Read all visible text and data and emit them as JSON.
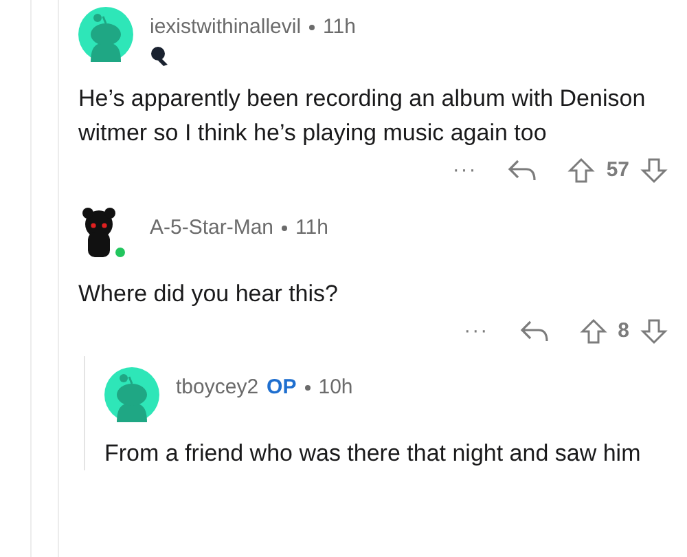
{
  "comments": [
    {
      "author": "iexistwithinallevil",
      "time": "11h",
      "flair": true,
      "avatar": {
        "kind": "snoo"
      },
      "body": "He’s apparently been recording an album with Denison witmer so I think he’s playing music again too",
      "more": "···",
      "score": "57"
    },
    {
      "author": "A-5-Star-Man",
      "time": "11h",
      "online": true,
      "avatar": {
        "kind": "custom"
      },
      "body": "Where did you hear this?",
      "more": "···",
      "score": "8",
      "children": [
        {
          "author": "tboycey2",
          "time": "10h",
          "badge": "OP",
          "avatar": {
            "kind": "snoo"
          },
          "body": "From a friend who was there that night and saw him"
        }
      ]
    }
  ]
}
